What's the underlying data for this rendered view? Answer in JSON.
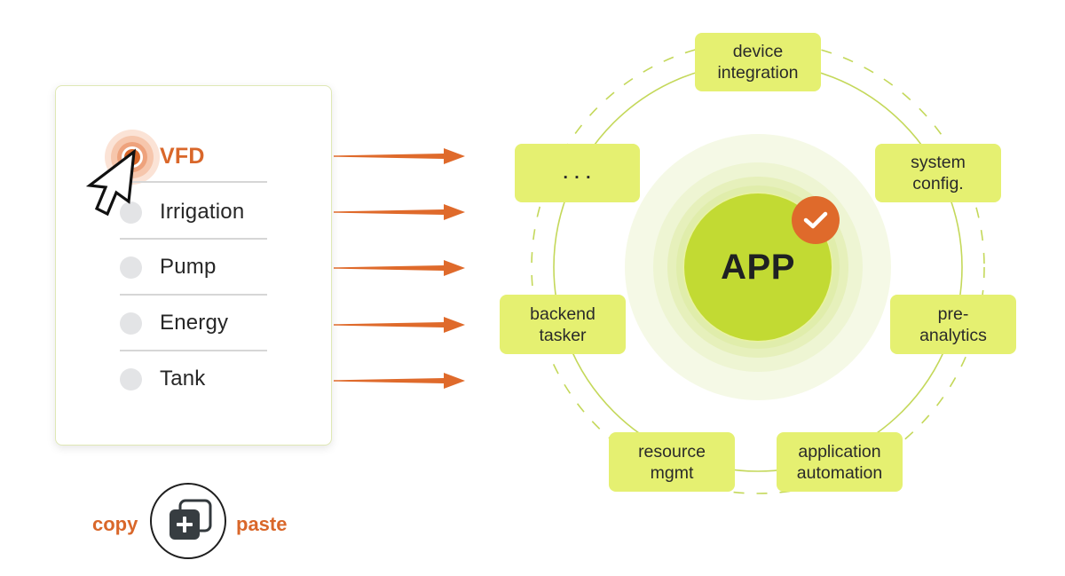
{
  "selector_card": {
    "options": [
      {
        "label": "VFD",
        "selected": true
      },
      {
        "label": "Irrigation",
        "selected": false
      },
      {
        "label": "Pump",
        "selected": false
      },
      {
        "label": "Energy",
        "selected": false
      },
      {
        "label": "Tank",
        "selected": false
      }
    ]
  },
  "copy_paste": {
    "copy_label": "copy",
    "paste_label": "paste",
    "icon": "copy-plus-icon"
  },
  "app_hub": {
    "center_label": "APP",
    "badge_icon": "check-icon",
    "nodes": [
      {
        "id": "device-integration",
        "label": "device\nintegration"
      },
      {
        "id": "system-config",
        "label": "system\nconfig."
      },
      {
        "id": "pre-analytics",
        "label": "pre-\nanalytics"
      },
      {
        "id": "application-automation",
        "label": "application\nautomation"
      },
      {
        "id": "resource-mgmt",
        "label": "resource\nmgmt"
      },
      {
        "id": "backend-tasker",
        "label": "backend\ntasker"
      },
      {
        "id": "more",
        "label": ". . ."
      }
    ]
  },
  "colors": {
    "accent_orange": "#d9672a",
    "node_fill": "#e5f071",
    "core_green": "#c2da33",
    "ring_line": "#c4d85a",
    "radio_idle": "#e3e4e6"
  }
}
